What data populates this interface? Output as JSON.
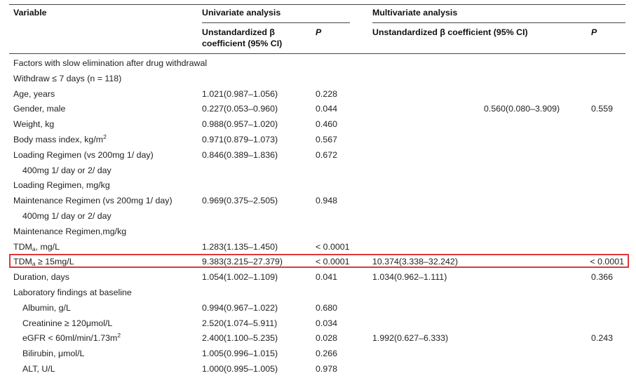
{
  "header": {
    "variable": "Variable",
    "univariate": "Univariate analysis",
    "multivariate": "Multivariate analysis",
    "uni_coef_line1": "Unstandardized β",
    "uni_coef_line2": "coefficient (95% CI)",
    "uni_p": "P",
    "multi_coef": "Unstandardized β coefficient (95% CI)",
    "multi_p": "P"
  },
  "rows": [
    {
      "label": "Factors with slow elimination after drug withdrawal",
      "indent": false,
      "uni_ci": "",
      "uni_p": "",
      "multi_ci": "",
      "multi_p": ""
    },
    {
      "label": "Withdraw ≤ 7 days (n = 118)",
      "indent": false,
      "uni_ci": "",
      "uni_p": "",
      "multi_ci": "",
      "multi_p": ""
    },
    {
      "label": "Age, years",
      "indent": false,
      "uni_ci": "1.021(0.987–1.056)",
      "uni_p": "0.228",
      "multi_ci": "",
      "multi_p": ""
    },
    {
      "label": "Gender, male",
      "indent": false,
      "uni_ci": "0.227(0.053–0.960)",
      "uni_p": "0.044",
      "multi_ci": "0.560(0.080–3.909)",
      "multi_p": "0.559"
    },
    {
      "label": "Weight, kg",
      "indent": false,
      "uni_ci": "0.988(0.957–1.020)",
      "uni_p": "0.460",
      "multi_ci": "",
      "multi_p": ""
    },
    {
      "label": "Body mass index, kg/m",
      "sup": "2",
      "indent": false,
      "uni_ci": "0.971(0.879–1.073)",
      "uni_p": "0.567",
      "multi_ci": "",
      "multi_p": ""
    },
    {
      "label": "Loading Regimen (vs 200mg 1/ day)",
      "indent": false,
      "uni_ci": "0.846(0.389–1.836)",
      "uni_p": "0.672",
      "multi_ci": "",
      "multi_p": ""
    },
    {
      "label": "400mg 1/ day or 2/ day",
      "indent": true,
      "uni_ci": "",
      "uni_p": "",
      "multi_ci": "",
      "multi_p": ""
    },
    {
      "label": "Loading Regimen, mg/kg",
      "indent": false,
      "uni_ci": "",
      "uni_p": "",
      "multi_ci": "",
      "multi_p": ""
    },
    {
      "label": "Maintenance Regimen (vs 200mg 1/ day)",
      "indent": false,
      "uni_ci": "0.969(0.375–2.505)",
      "uni_p": "0.948",
      "multi_ci": "",
      "multi_p": ""
    },
    {
      "label": "400mg 1/ day or 2/ day",
      "indent": true,
      "uni_ci": "",
      "uni_p": "",
      "multi_ci": "",
      "multi_p": ""
    },
    {
      "label": "Maintenance Regimen,mg/kg",
      "indent": false,
      "uni_ci": "",
      "uni_p": "",
      "multi_ci": "",
      "multi_p": ""
    },
    {
      "label": "TDM",
      "sub": "a",
      "label_after": ", mg/L",
      "indent": false,
      "uni_ci": "1.283(1.135–1.450)",
      "uni_p": "< 0.0001",
      "multi_ci": "",
      "multi_p": ""
    },
    {
      "label": "TDM",
      "sub": "a",
      "label_after": " ≥ 15mg/L",
      "indent": false,
      "uni_ci": "9.383(3.215–27.379)",
      "uni_p": "< 0.0001",
      "multi_ci": "10.374(3.338–32.242)",
      "multi_p": "< 0.0001",
      "highlighted": true
    },
    {
      "label": "Duration, days",
      "indent": false,
      "uni_ci": "1.054(1.002–1.109)",
      "uni_p": "0.041",
      "multi_ci": "1.034(0.962–1.111)",
      "multi_p": "0.366"
    },
    {
      "label": "Laboratory findings at baseline",
      "indent": false,
      "uni_ci": "",
      "uni_p": "",
      "multi_ci": "",
      "multi_p": ""
    },
    {
      "label": "Albumin, g/L",
      "indent": true,
      "uni_ci": "0.994(0.967–1.022)",
      "uni_p": "0.680",
      "multi_ci": "",
      "multi_p": ""
    },
    {
      "label": "Creatinine ≥ 120μmol/L",
      "indent": true,
      "uni_ci": "2.520(1.074–5.911)",
      "uni_p": "0.034",
      "multi_ci": "",
      "multi_p": ""
    },
    {
      "label": "eGFR < 60ml/min/1.73m",
      "sup": "2",
      "indent": true,
      "uni_ci": "2.400(1.100–5.235)",
      "uni_p": "0.028",
      "multi_ci": "1.992(0.627–6.333)",
      "multi_p": "0.243"
    },
    {
      "label": "Bilirubin, μmol/L",
      "indent": true,
      "uni_ci": "1.005(0.996–1.015)",
      "uni_p": "0.266",
      "multi_ci": "",
      "multi_p": ""
    },
    {
      "label": "ALT, U/L",
      "indent": true,
      "uni_ci": "1.000(0.995–1.005)",
      "uni_p": "0.978",
      "multi_ci": "",
      "multi_p": ""
    }
  ],
  "colors": {
    "highlight_border": "#e0383a",
    "rule": "#444444",
    "text": "#222222"
  }
}
